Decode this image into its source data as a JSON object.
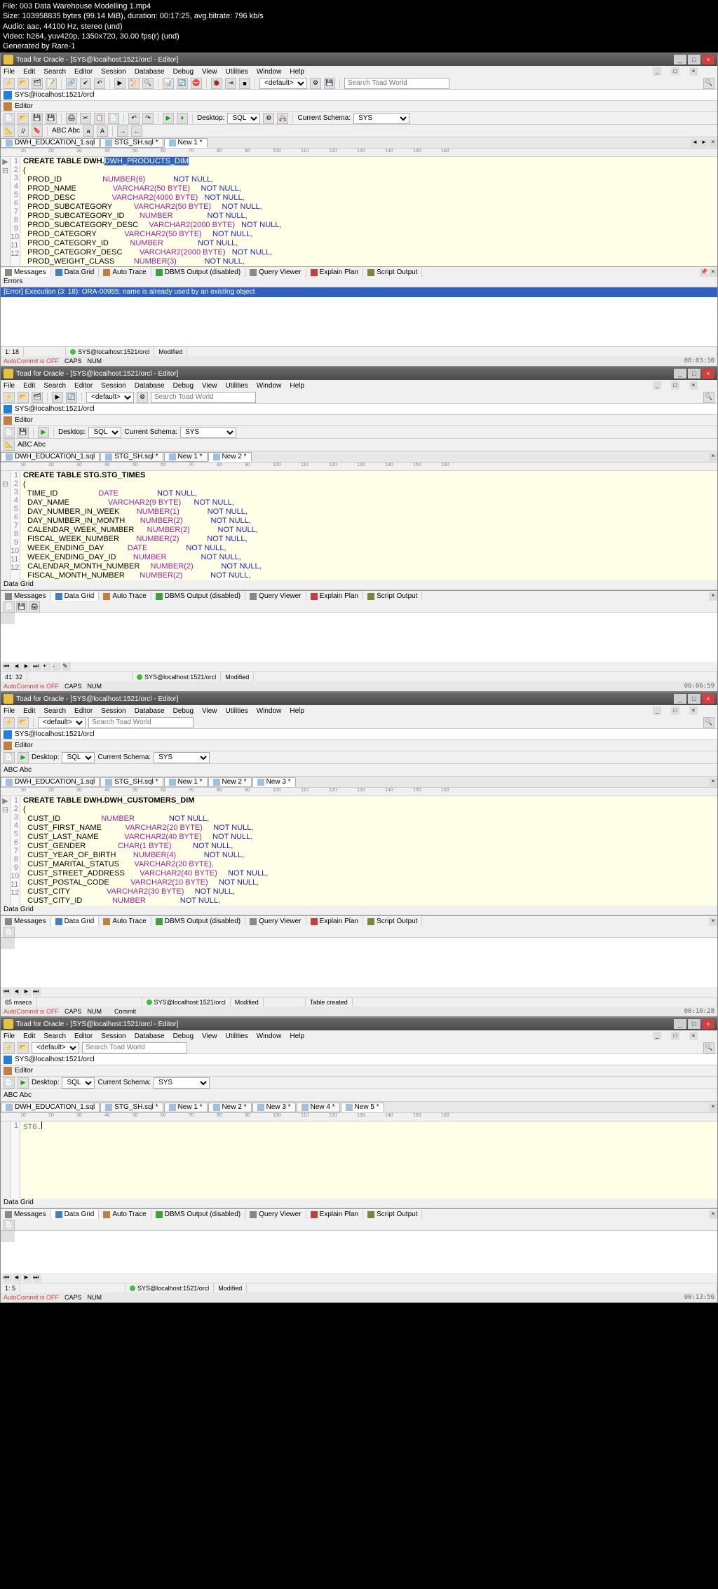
{
  "meta": {
    "file": "File: 003 Data Warehouse Modelling 1.mp4",
    "size": "Size: 103958835 bytes (99.14 MiB), duration: 00:17:25, avg.bitrate: 796 kb/s",
    "audio": "Audio: aac, 44100 Hz, stereo (und)",
    "video": "Video: h264, yuv420p, 1350x720, 30.00 fps(r) (und)",
    "gen": "Generated by Rare-1"
  },
  "app_title": "Toad for Oracle - [SYS@localhost:1521/orcl - Editor]",
  "menu": [
    "File",
    "Edit",
    "Search",
    "Editor",
    "Session",
    "Database",
    "Debug",
    "View",
    "Utilities",
    "Window",
    "Help"
  ],
  "conn": "SYS@localhost:1521/orcl",
  "editor_label": "Editor",
  "toolbar": {
    "default": "<default>",
    "desktop": "Desktop:",
    "sql": "SQL",
    "schema": "Current Schema:",
    "schema_val": "SYS",
    "abc": "ABC Abc",
    "search_ph": "Search Toad World"
  },
  "tabs": {
    "t1": "DWH_EDUCATION_1.sql",
    "t2": "STG_SH.sql *",
    "new1": "New 1 *",
    "new2": "New 2 *",
    "new3": "New 3 *",
    "new4": "New 4 *",
    "new5": "New 5 *"
  },
  "ruler": [
    "10",
    "20",
    "30",
    "40",
    "50",
    "60",
    "70",
    "80",
    "90",
    "100",
    "110",
    "120",
    "130",
    "140",
    "150",
    "160"
  ],
  "output_tabs": {
    "messages": "Messages",
    "datagrid": "Data Grid",
    "autotrace": "Auto Trace",
    "dbms": "DBMS Output (disabled)",
    "query": "Query Viewer",
    "explain": "Explain Plan",
    "script": "Script Output"
  },
  "code1": {
    "l1_a": "CREATE TABLE DWH.",
    "l1_b": "DWH_PRODUCTS_DIM",
    "l2": "(",
    "rows": [
      {
        "n": "PROD_ID",
        "t": "NUMBER(6)",
        "c": "NOT NULL,"
      },
      {
        "n": "PROD_NAME",
        "t": "VARCHAR2(50 BYTE)",
        "c": "NOT NULL,"
      },
      {
        "n": "PROD_DESC",
        "t": "VARCHAR2(4000 BYTE)",
        "c": "NOT NULL,"
      },
      {
        "n": "PROD_SUBCATEGORY",
        "t": "VARCHAR2(50 BYTE)",
        "c": "NOT NULL,"
      },
      {
        "n": "PROD_SUBCATEGORY_ID",
        "t": "NUMBER",
        "c": "NOT NULL,"
      },
      {
        "n": "PROD_SUBCATEGORY_DESC",
        "t": "VARCHAR2(2000 BYTE)",
        "c": "NOT NULL,"
      },
      {
        "n": "PROD_CATEGORY",
        "t": "VARCHAR2(50 BYTE)",
        "c": "NOT NULL,"
      },
      {
        "n": "PROD_CATEGORY_ID",
        "t": "NUMBER",
        "c": "NOT NULL,"
      },
      {
        "n": "PROD_CATEGORY_DESC",
        "t": "VARCHAR2(2000 BYTE)",
        "c": "NOT NULL,"
      },
      {
        "n": "PROD_WEIGHT_CLASS",
        "t": "NUMBER(3)",
        "c": "NOT NULL,"
      }
    ]
  },
  "errors_label": "Errors",
  "error_text": "[Error] Execution (3: 18): ORA-00955: name is already used by an existing object",
  "status1": {
    "pos": "1: 18",
    "conn": "SYS@localhost:1521/orcl",
    "mod": "Modified"
  },
  "footer1": {
    "ac": "AutoCommit is OFF",
    "caps": "CAPS",
    "num": "NUM",
    "ts": "00:03:30"
  },
  "code2": {
    "l1": "CREATE TABLE STG.STG_TIMES",
    "l2": "(",
    "rows": [
      {
        "n": "TIME_ID",
        "t": "DATE",
        "c": "NOT NULL,"
      },
      {
        "n": "DAY_NAME",
        "t": "VARCHAR2(9 BYTE)",
        "c": "NOT NULL,"
      },
      {
        "n": "DAY_NUMBER_IN_WEEK",
        "t": "NUMBER(1)",
        "c": "NOT NULL,"
      },
      {
        "n": "DAY_NUMBER_IN_MONTH",
        "t": "NUMBER(2)",
        "c": "NOT NULL,"
      },
      {
        "n": "CALENDAR_WEEK_NUMBER",
        "t": "NUMBER(2)",
        "c": "NOT NULL,"
      },
      {
        "n": "FISCAL_WEEK_NUMBER",
        "t": "NUMBER(2)",
        "c": "NOT NULL,"
      },
      {
        "n": "WEEK_ENDING_DAY",
        "t": "DATE",
        "c": "NOT NULL,"
      },
      {
        "n": "WEEK_ENDING_DAY_ID",
        "t": "NUMBER",
        "c": "NOT NULL,"
      },
      {
        "n": "CALENDAR_MONTH_NUMBER",
        "t": "NUMBER(2)",
        "c": "NOT NULL,"
      },
      {
        "n": "FISCAL_MONTH_NUMBER",
        "t": "NUMBER(2)",
        "c": "NOT NULL,"
      }
    ]
  },
  "grid_label": "Data Grid",
  "status2": {
    "pos": "41: 32",
    "conn": "SYS@localhost:1521/orcl",
    "mod": "Modified"
  },
  "footer2": {
    "ac": "AutoCommit is OFF",
    "caps": "CAPS",
    "num": "NUM",
    "ts": "00:06:59"
  },
  "code3": {
    "l1": "CREATE TABLE DWH.DWH_CUSTOMERS_DIM",
    "l2": "(",
    "rows": [
      {
        "n": "CUST_ID",
        "t": "NUMBER",
        "c": "NOT NULL,"
      },
      {
        "n": "CUST_FIRST_NAME",
        "t": "VARCHAR2(20 BYTE)",
        "c": "NOT NULL,"
      },
      {
        "n": "CUST_LAST_NAME",
        "t": "VARCHAR2(40 BYTE)",
        "c": "NOT NULL,"
      },
      {
        "n": "CUST_GENDER",
        "t": "CHAR(1 BYTE)",
        "c": "NOT NULL,"
      },
      {
        "n": "CUST_YEAR_OF_BIRTH",
        "t": "NUMBER(4)",
        "c": "NOT NULL,"
      },
      {
        "n": "CUST_MARITAL_STATUS",
        "t": "VARCHAR2(20 BYTE),",
        "c": ""
      },
      {
        "n": "CUST_STREET_ADDRESS",
        "t": "VARCHAR2(40 BYTE)",
        "c": "NOT NULL,"
      },
      {
        "n": "CUST_POSTAL_CODE",
        "t": "VARCHAR2(10 BYTE)",
        "c": "NOT NULL,"
      },
      {
        "n": "CUST_CITY",
        "t": "VARCHAR2(30 BYTE)",
        "c": "NOT NULL,"
      },
      {
        "n": "CUST_CITY_ID",
        "t": "NUMBER",
        "c": "NOT NULL,"
      }
    ]
  },
  "status3": {
    "pos": "65 msecs",
    "conn": "SYS@localhost:1521/orcl",
    "mod": "Modified",
    "extra": "Table created"
  },
  "footer3": {
    "ac": "AutoCommit is OFF",
    "caps": "CAPS",
    "num": "NUM",
    "commit": "Commit",
    "ts": "00:10:28"
  },
  "code4": {
    "text": "STG."
  },
  "status4": {
    "pos": "1: 5",
    "conn": "SYS@localhost:1521/orcl",
    "mod": "Modified"
  },
  "footer4": {
    "ac": "AutoCommit is OFF",
    "caps": "CAPS",
    "num": "NUM",
    "ts": "00:13:56"
  }
}
